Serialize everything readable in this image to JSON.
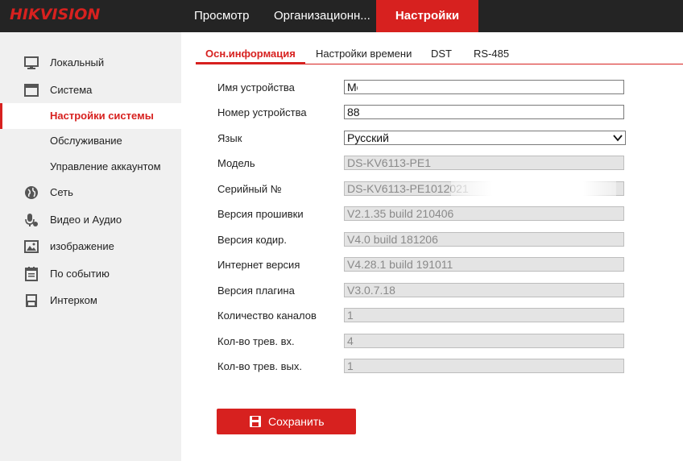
{
  "brand": {
    "logo_text": "HIKVISION",
    "accent": "#d7211f"
  },
  "top_nav": [
    {
      "label": "Просмотр"
    },
    {
      "label": "Организационн..."
    },
    {
      "label": "Настройки",
      "active": true
    }
  ],
  "sidebar": {
    "items": [
      {
        "label": "Локальный",
        "icon": "monitor-icon"
      },
      {
        "label": "Система",
        "icon": "system-icon"
      },
      {
        "label": "Настройки системы",
        "active": true
      },
      {
        "label": "Обслуживание"
      },
      {
        "label": "Управление аккаунтом"
      },
      {
        "label": "Сеть",
        "icon": "globe-icon"
      },
      {
        "label": "Видео и Аудио",
        "icon": "microphone-icon"
      },
      {
        "label": "изображение",
        "icon": "image-icon"
      },
      {
        "label": "По событию",
        "icon": "calendar-icon"
      },
      {
        "label": "Интерком",
        "icon": "intercom-icon"
      }
    ]
  },
  "subtabs": [
    {
      "label": "Осн.информация",
      "active": true
    },
    {
      "label": "Настройки времени"
    },
    {
      "label": "DST"
    },
    {
      "label": "RS-485"
    }
  ],
  "form": {
    "device_name": {
      "label": "Имя устройства",
      "value": "Mo"
    },
    "device_number": {
      "label": "Номер устройства",
      "value": "88"
    },
    "language": {
      "label": "Язык",
      "value": "Русский"
    },
    "model": {
      "label": "Модель",
      "value": "DS-KV6113-PE1"
    },
    "serial": {
      "label": "Серийный №",
      "value": "DS-KV6113-PE1012021"
    },
    "firmware": {
      "label": "Версия прошивки",
      "value": "V2.1.35 build 210406"
    },
    "encoding": {
      "label": "Версия кодир.",
      "value": "V4.0 build 181206"
    },
    "web": {
      "label": "Интернет версия",
      "value": "V4.28.1 build 191011"
    },
    "plugin": {
      "label": "Версия плагина",
      "value": "V3.0.7.18"
    },
    "channels": {
      "label": "Количество каналов",
      "value": "1"
    },
    "alarm_in": {
      "label": "Кол-во трев. вх.",
      "value": "4"
    },
    "alarm_out": {
      "label": "Кол-во трев. вых.",
      "value": "1"
    }
  },
  "actions": {
    "save_label": "Сохранить",
    "save_icon": "floppy-disk-icon"
  }
}
